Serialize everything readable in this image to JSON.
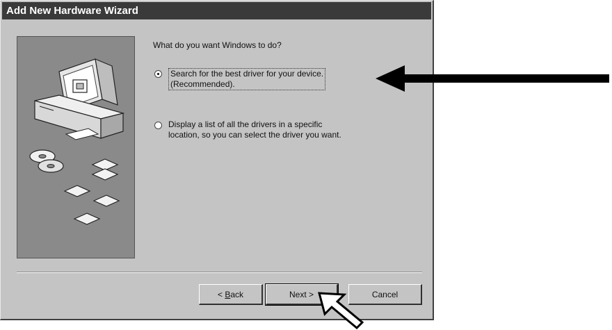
{
  "window": {
    "title": "Add New Hardware Wizard"
  },
  "main": {
    "question": "What do you want Windows to do?",
    "options": [
      {
        "label": "Search for the best driver for your device.\n(Recommended).",
        "selected": true
      },
      {
        "label": "Display a list of all the drivers in a specific\nlocation, so you can select the driver you want.",
        "selected": false
      }
    ]
  },
  "buttons": {
    "back": {
      "mnemonic": "B",
      "rest": "ack",
      "prefix": "< "
    },
    "next": "Next >",
    "cancel": "Cancel"
  },
  "illustration": {
    "icons": [
      "computer-icon",
      "cd-discs-icon",
      "driver-diskette-icon"
    ]
  },
  "annotations": {
    "pointer_arrow_icon": "left-arrow-icon",
    "cursor_icon": "mouse-cursor-icon"
  }
}
